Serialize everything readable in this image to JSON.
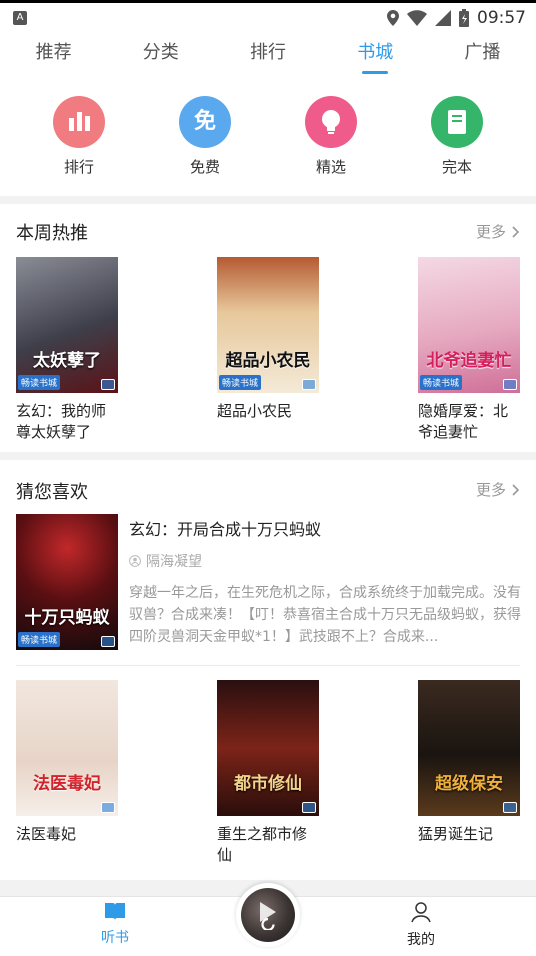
{
  "status_bar": {
    "time": "09:57",
    "app_icon_letter": "A"
  },
  "top_tabs": [
    {
      "label": "推荐",
      "active": false
    },
    {
      "label": "分类",
      "active": false
    },
    {
      "label": "排行",
      "active": false
    },
    {
      "label": "书城",
      "active": true
    },
    {
      "label": "广播",
      "active": false
    }
  ],
  "quick_entries": [
    {
      "label": "排行",
      "icon": "bar-chart-icon",
      "color": "#f07b80"
    },
    {
      "label": "免费",
      "icon": "free-icon",
      "icon_text": "免",
      "color": "#5aa8ee"
    },
    {
      "label": "精选",
      "icon": "lightbulb-icon",
      "color": "#ef5b8a"
    },
    {
      "label": "完本",
      "icon": "book-icon",
      "color": "#34b56a"
    }
  ],
  "weekly": {
    "title": "本周热推",
    "more": "更多",
    "books": [
      {
        "name": "玄幻：我的师尊太妖孽了",
        "cover_text": "太妖孽了",
        "cover_badge": "畅读书城",
        "cover_color": "#5a5b66"
      },
      {
        "name": "超品小农民",
        "cover_text": "超品小农民",
        "cover_badge": "畅读书城",
        "cover_color": "#d8b27a"
      },
      {
        "name": "隐婚厚爱：北爷追妻忙",
        "cover_text": "北爷追妻忙",
        "cover_badge": "畅读书城",
        "cover_color": "#e8b2c6"
      }
    ]
  },
  "guess": {
    "title": "猜您喜欢",
    "more": "更多",
    "featured": {
      "title": "玄幻：开局合成十万只蚂蚁",
      "author": "隔海凝望",
      "desc": "穿越一年之后，在生死危机之际，合成系统终于加载完成。没有驭兽？合成来凑！【叮！恭喜宿主合成十万只无品级蚂蚁，获得四阶灵兽洞天金甲蚁*1！】武技跟不上？合成来...",
      "cover_text": "十万只蚂蚁",
      "cover_badge": "畅读书城",
      "cover_color": "#3a1418"
    },
    "books": [
      {
        "name": "法医毒妃",
        "cover_text": "法医毒妃",
        "cover_color": "#e8d8cc"
      },
      {
        "name": "重生之都市修仙",
        "cover_text": "都市修仙",
        "cover_color": "#4a1c18"
      },
      {
        "name": "猛男诞生记",
        "cover_text": "超级保安",
        "cover_color": "#2a1c14"
      }
    ]
  },
  "bottom_nav": {
    "left_label": "听书",
    "right_label": "我的"
  }
}
